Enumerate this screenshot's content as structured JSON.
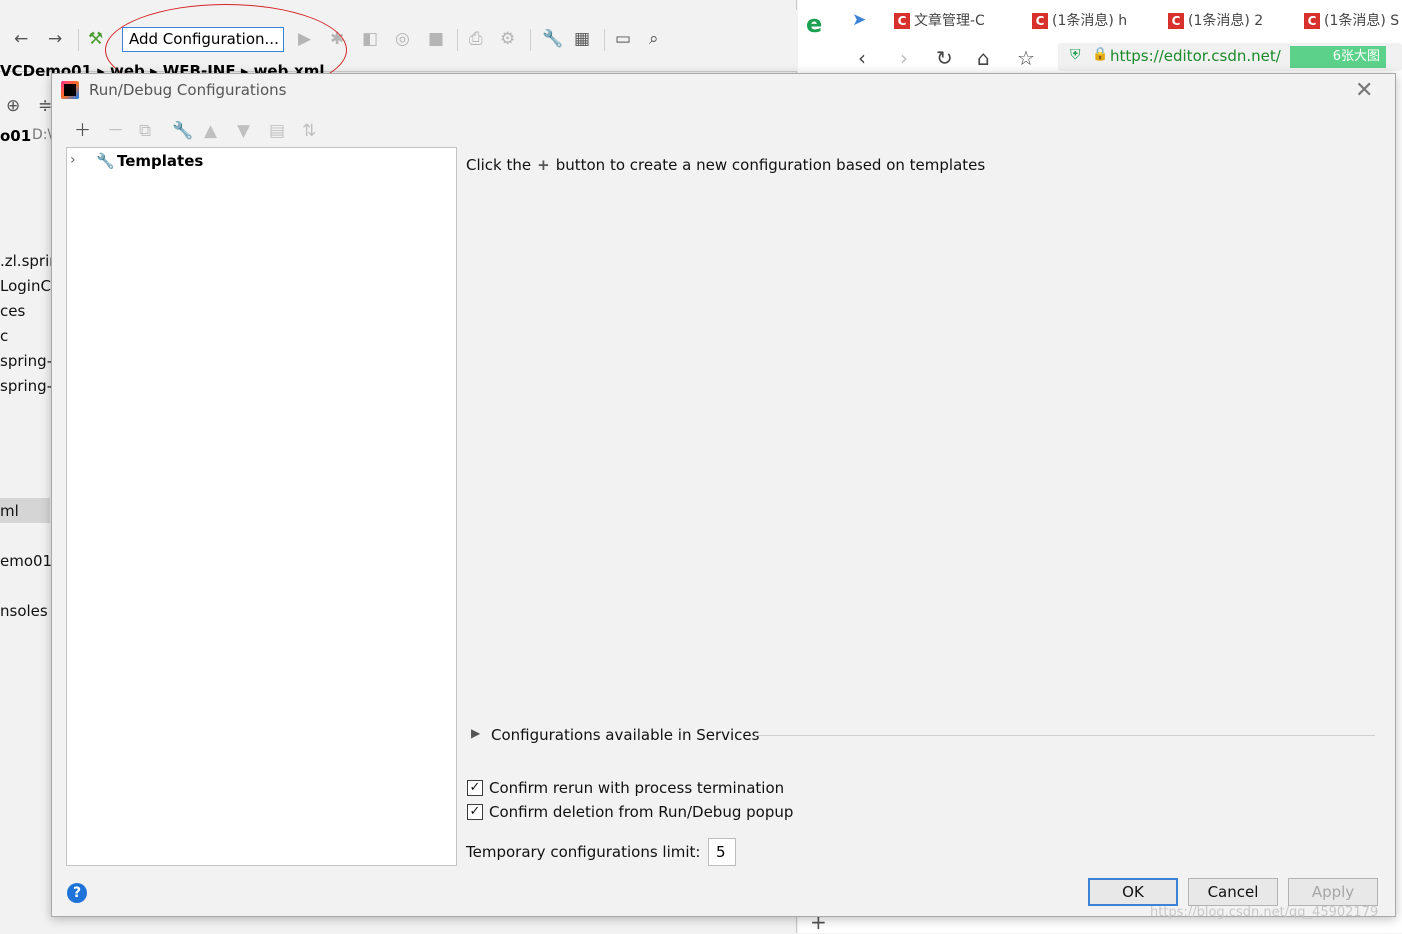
{
  "ide": {
    "toolbar": {
      "add_config_label": "Add Configuration..."
    },
    "breadcrumb": "VCDemo01 ▸ web ▸ WEB-INF ▸ web.xml",
    "project_label": "o01",
    "project_path": "D:\\",
    "sidebar_texts": [
      ".zl.sprin",
      "LoginC",
      "ces",
      "c",
      "spring-",
      "spring-",
      "ml",
      "emo01.",
      "nsoles"
    ]
  },
  "browser": {
    "tabs": [
      {
        "label": "文章管理-C"
      },
      {
        "label": "(1条消息) h"
      },
      {
        "label": "(1条消息) 2"
      },
      {
        "label": "(1条消息) S"
      }
    ],
    "url": "https://editor.csdn.net/",
    "image_badge": "6张大图",
    "watermark": "https://blog.csdn.net/qq_45902179"
  },
  "dialog": {
    "title": "Run/Debug Configurations",
    "tree": {
      "items": [
        {
          "label": "Templates"
        }
      ]
    },
    "hint_before": "Click the",
    "hint_after": "button to create a new configuration based on templates",
    "services_label": "Configurations available in Services",
    "checkbox_rerun": {
      "label": "Confirm rerun with process termination",
      "checked": true
    },
    "checkbox_deletion": {
      "label": "Confirm deletion from Run/Debug popup",
      "checked": true
    },
    "temp_limit_label": "Temporary configurations limit:",
    "temp_limit_value": "5",
    "buttons": {
      "ok": "OK",
      "cancel": "Cancel",
      "apply": "Apply"
    }
  },
  "colors": {
    "accent": "#3d82d6",
    "annotation": "#d42525",
    "url_green": "#1a8a2a"
  }
}
